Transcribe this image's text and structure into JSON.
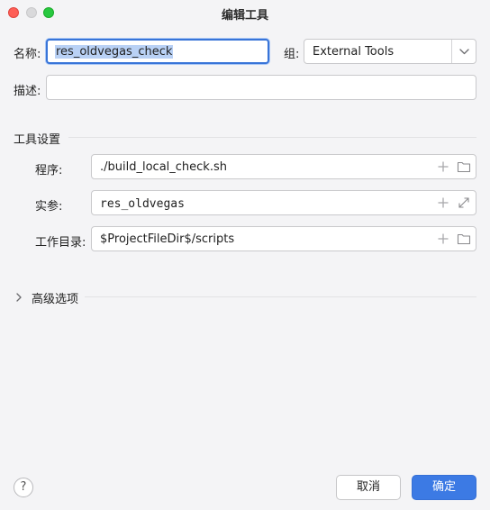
{
  "window": {
    "title": "编辑工具"
  },
  "form": {
    "name_label": "名称:",
    "name_value": "res_oldvegas_check",
    "group_label": "组:",
    "group_value": "External Tools",
    "description_label": "描述:",
    "description_value": ""
  },
  "tool_settings": {
    "header": "工具设置",
    "program_label": "程序:",
    "program_value": "./build_local_check.sh",
    "args_label": "实参:",
    "args_value": "res_oldvegas",
    "workdir_label": "工作目录:",
    "workdir_value": "$ProjectFileDir$/scripts"
  },
  "advanced": {
    "label": "高级选项"
  },
  "buttons": {
    "cancel": "取消",
    "ok": "确定",
    "help": "?"
  },
  "colors": {
    "accent": "#3c7ae4",
    "focus_border": "#3874d8",
    "selection": "#b9d1f5"
  }
}
